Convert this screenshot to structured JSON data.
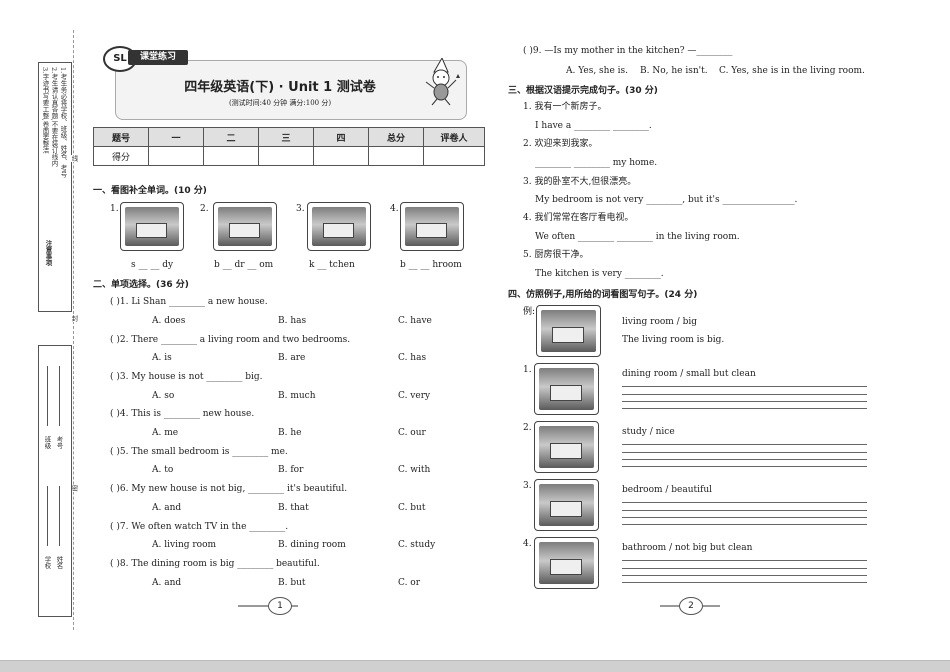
{
  "header": {
    "logo": "SL",
    "ribbon": "课堂练习",
    "title": "四年级英语(下) · Unit 1 测试卷",
    "subtitle": "(测试时间:40 分钟    满分:100 分)"
  },
  "margin": {
    "notes": [
      "1.考生务必将学校、班级、姓名、考号",
      "2.考生请认真答题,不要在装订线内",
      "3.字迹书写要工整,卷面要整洁"
    ],
    "note_title": "注意事项",
    "line_char_1": "线",
    "line_char_2": "封",
    "line_char_3": "密",
    "fields": [
      "学校",
      "姓名",
      "班级",
      "考号"
    ]
  },
  "score_table": {
    "headers": [
      "题号",
      "一",
      "二",
      "三",
      "四",
      "总分",
      "评卷人"
    ],
    "row_label": "得分"
  },
  "section1": {
    "title": "一、看图补全单词。(10 分)",
    "items": [
      {
        "num": "1.",
        "word": "s __ __ dy"
      },
      {
        "num": "2.",
        "word": "b __ dr __ om"
      },
      {
        "num": "3.",
        "word": "k __ tchen"
      },
      {
        "num": "4.",
        "word": "b __ __ hroom"
      }
    ]
  },
  "section2": {
    "title": "二、单项选择。(36 分)",
    "questions": [
      {
        "q": "(      )1. Li Shan ________ a new house.",
        "a": "A. does",
        "b": "B. has",
        "c": "C. have"
      },
      {
        "q": "(      )2. There ________ a living room and two bedrooms.",
        "a": "A. is",
        "b": "B. are",
        "c": "C. has"
      },
      {
        "q": "(      )3. My house is not ________ big.",
        "a": "A. so",
        "b": "B. much",
        "c": "C. very"
      },
      {
        "q": "(      )4. This is ________ new house.",
        "a": "A. me",
        "b": "B. he",
        "c": "C. our"
      },
      {
        "q": "(      )5. The small bedroom is ________ me.",
        "a": "A. to",
        "b": "B. for",
        "c": "C. with"
      },
      {
        "q": "(      )6. My new house is not big, ________ it's beautiful.",
        "a": "A. and",
        "b": "B. that",
        "c": "C. but"
      },
      {
        "q": "(      )7. We often watch TV in the ________.",
        "a": "A. living room",
        "b": "B. dining room",
        "c": "C. study"
      },
      {
        "q": "(      )8. The dining room is big ________ beautiful.",
        "a": "A. and",
        "b": "B. but",
        "c": "C. or"
      }
    ]
  },
  "q9": {
    "q": "(      )9. —Is my mother in the kitchen?    —________",
    "a": "A. Yes, she is.",
    "b": "B. No, he isn't.",
    "c": "C. Yes, she is in the living room."
  },
  "section3": {
    "title": "三、根据汉语提示完成句子。(30 分)",
    "items": [
      {
        "cn": "1. 我有一个新房子。",
        "en": "I have a ________ ________."
      },
      {
        "cn": "2. 欢迎来到我家。",
        "en": "________ ________ my home."
      },
      {
        "cn": "3. 我的卧室不大,但很漂亮。",
        "en": "My bedroom is not very ________, but it's ________________."
      },
      {
        "cn": "4. 我们常常在客厅看电视。",
        "en": "We often ________ ________ in the living room."
      },
      {
        "cn": "5. 厨房很干净。",
        "en": "The kitchen is very ________."
      }
    ]
  },
  "section4": {
    "title": "四、仿照例子,用所给的词看图写句子。(24 分)",
    "example_label": "例:",
    "example_prompt": "living room / big",
    "example_answer": "The living room is big.",
    "items": [
      {
        "num": "1.",
        "prompt": "dining room / small but clean"
      },
      {
        "num": "2.",
        "prompt": "study / nice"
      },
      {
        "num": "3.",
        "prompt": "bedroom / beautiful"
      },
      {
        "num": "4.",
        "prompt": "bathroom / not big but clean"
      }
    ]
  },
  "footer": {
    "page1": "1",
    "page2": "2"
  }
}
